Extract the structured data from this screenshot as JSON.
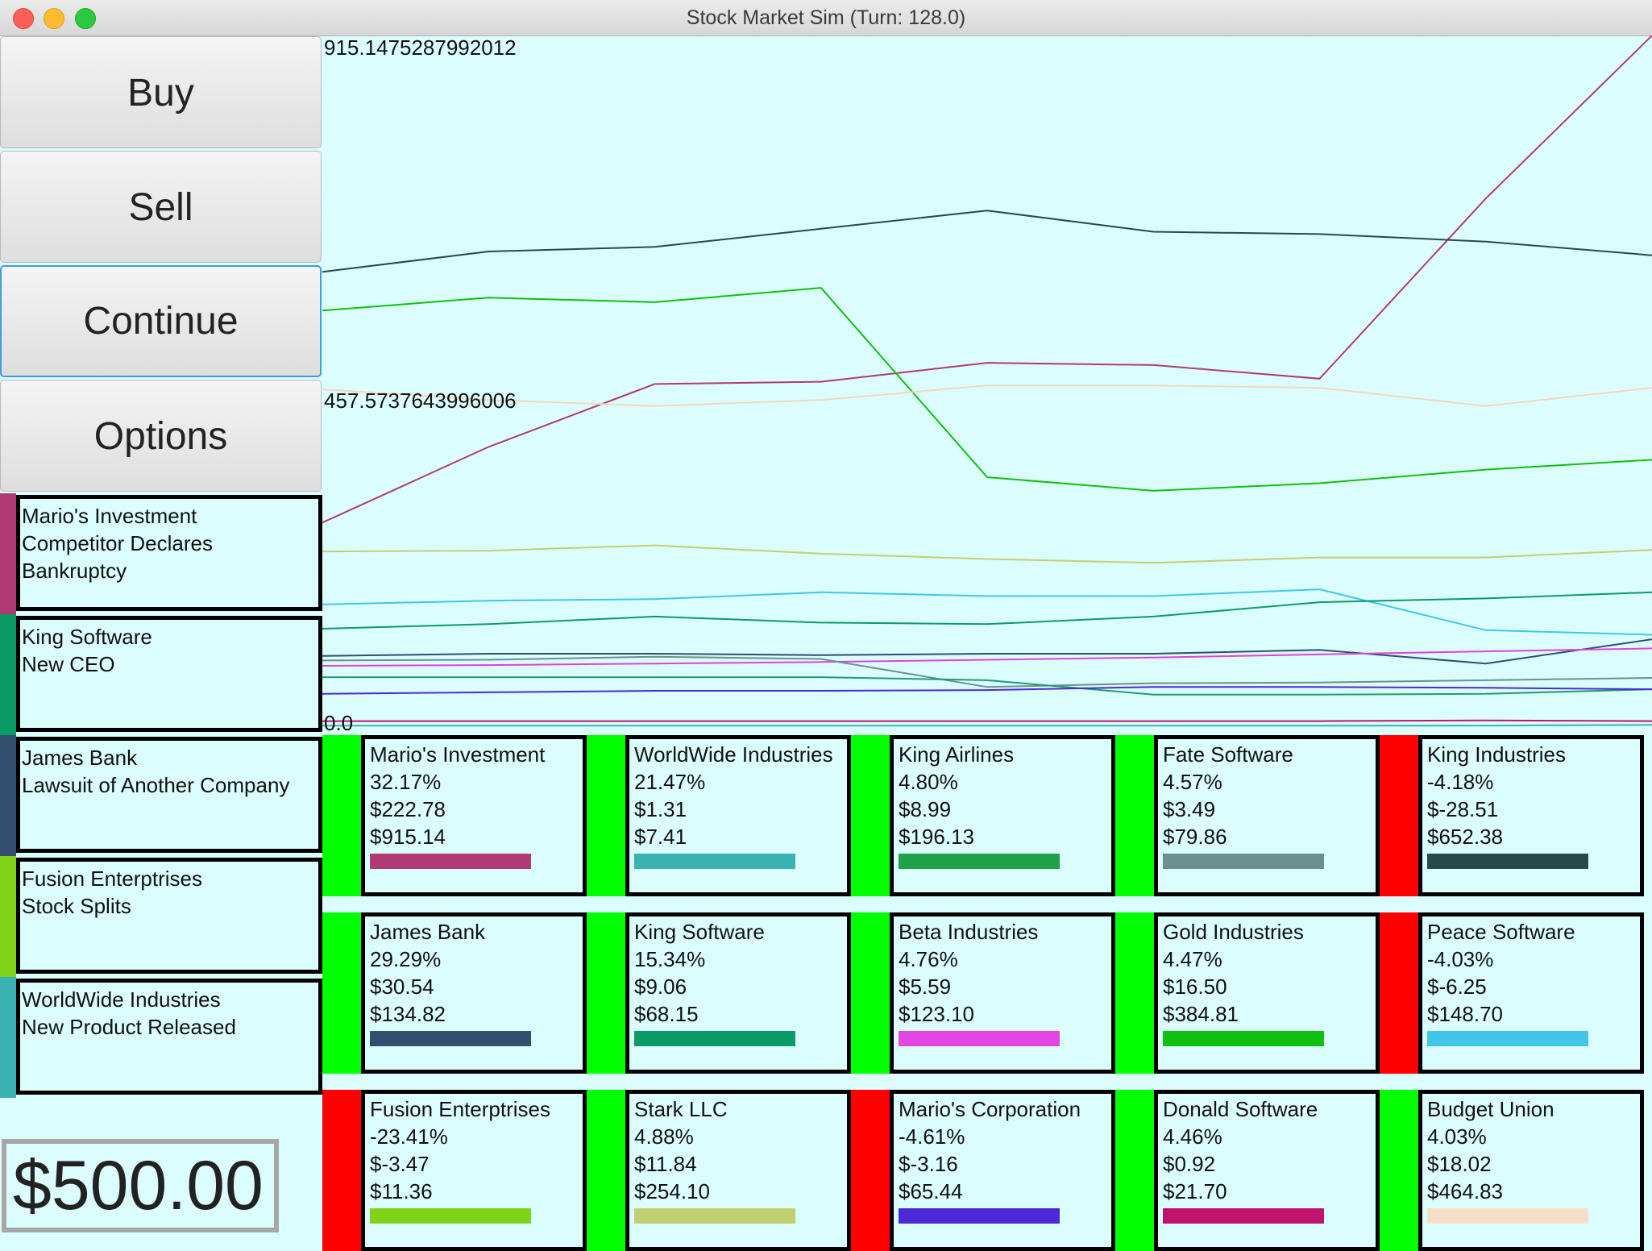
{
  "window": {
    "title": "Stock Market Sim (Turn: 128.0)"
  },
  "controls": {
    "buy": "Buy",
    "sell": "Sell",
    "continue": "Continue",
    "options": "Options"
  },
  "news": [
    {
      "text": "Mario's Investment\nCompetitor Declares\nBankruptcy",
      "color": "#b03a74"
    },
    {
      "text": "King Software\nNew CEO",
      "color": "#0b9b67"
    },
    {
      "text": "James Bank\nLawsuit of Another Company",
      "color": "#344e6f"
    },
    {
      "text": "Fusion Enterptrises\nStock Splits",
      "color": "#7fd41a"
    },
    {
      "text": "WorldWide Industries\nNew Product Released",
      "color": "#3ab2b4"
    }
  ],
  "cash": "$500.00",
  "chart_data": {
    "type": "line",
    "y_tick_labels": [
      "915.1475287992012",
      "457.5737643996006",
      "0.0"
    ],
    "ylim": [
      0,
      915.1475287992012
    ],
    "x": [
      0,
      1,
      2,
      3,
      4,
      5,
      6,
      7,
      8
    ],
    "series": [
      {
        "color": "#b03a74",
        "values": [
          272,
          372,
          455,
          458,
          483,
          480,
          462,
          700,
          915
        ]
      },
      {
        "color": "#264a4a",
        "values": [
          603,
          630,
          636,
          660,
          684,
          656,
          653,
          643,
          625
        ]
      },
      {
        "color": "#10c010",
        "values": [
          552,
          569,
          563,
          582,
          332,
          314,
          324,
          342,
          355
        ]
      },
      {
        "color": "#f2d8bf",
        "values": [
          448,
          434,
          426,
          434,
          453,
          453,
          450,
          426,
          450
        ]
      },
      {
        "color": "#c2cf72",
        "values": [
          234,
          235,
          242,
          231,
          224,
          219,
          226,
          226,
          236
        ]
      },
      {
        "color": "#41c6e8",
        "values": [
          164,
          169,
          171,
          180,
          175,
          175,
          184,
          130,
          124
        ]
      },
      {
        "color": "#0b9b67",
        "values": [
          132,
          138,
          148,
          140,
          138,
          148,
          167,
          172,
          180
        ]
      },
      {
        "color": "#2f4f6f",
        "values": [
          96,
          99,
          99,
          97,
          99,
          99,
          104,
          86,
          118
        ]
      },
      {
        "color": "#e040e0",
        "values": [
          83,
          84,
          86,
          88,
          91,
          94,
          98,
          102,
          106
        ]
      },
      {
        "color": "#6a9090",
        "values": [
          90,
          91,
          95,
          92,
          55,
          60,
          61,
          64,
          67
        ]
      },
      {
        "color": "#1e9d6a",
        "values": [
          68,
          68,
          68,
          68,
          64,
          45,
          45,
          46,
          52
        ]
      },
      {
        "color": "#4a2ad6",
        "values": [
          46,
          48,
          50,
          50,
          51,
          55,
          55,
          54,
          52
        ]
      },
      {
        "color": "#c0146c",
        "values": [
          10,
          10,
          10,
          10,
          10,
          10,
          10,
          11,
          10
        ]
      },
      {
        "color": "#3ab2b4",
        "values": [
          4,
          4,
          4,
          4,
          4,
          4,
          4,
          4,
          5
        ]
      }
    ]
  },
  "stocks": [
    {
      "name": "Mario's Investment",
      "pct": "32.17%",
      "change": "$222.78",
      "price": "$915.14",
      "up": true,
      "color": "#b03a74"
    },
    {
      "name": "WorldWide Industries",
      "pct": "21.47%",
      "change": "$1.31",
      "price": "$7.41",
      "up": true,
      "color": "#3ab2b4"
    },
    {
      "name": "King Airlines",
      "pct": "4.80%",
      "change": "$8.99",
      "price": "$196.13",
      "up": true,
      "color": "#1fa149"
    },
    {
      "name": "Fate Software",
      "pct": "4.57%",
      "change": "$3.49",
      "price": "$79.86",
      "up": true,
      "color": "#6a9090"
    },
    {
      "name": "King Industries",
      "pct": "-4.18%",
      "change": "$-28.51",
      "price": "$652.38",
      "up": false,
      "color": "#264a4a"
    },
    {
      "name": "James Bank",
      "pct": "29.29%",
      "change": "$30.54",
      "price": "$134.82",
      "up": true,
      "color": "#344e6f"
    },
    {
      "name": "King Software",
      "pct": "15.34%",
      "change": "$9.06",
      "price": "$68.15",
      "up": true,
      "color": "#0b9b67"
    },
    {
      "name": "Beta Industries",
      "pct": "4.76%",
      "change": "$5.59",
      "price": "$123.10",
      "up": true,
      "color": "#e446e4"
    },
    {
      "name": "Gold Industries",
      "pct": "4.47%",
      "change": "$16.50",
      "price": "$384.81",
      "up": true,
      "color": "#10c010"
    },
    {
      "name": "Peace Software",
      "pct": "-4.03%",
      "change": "$-6.25",
      "price": "$148.70",
      "up": false,
      "color": "#41c6e8"
    },
    {
      "name": "Fusion Enterptrises",
      "pct": "-23.41%",
      "change": "$-3.47",
      "price": "$11.36",
      "up": false,
      "color": "#7fd41a"
    },
    {
      "name": "Stark LLC",
      "pct": "4.88%",
      "change": "$11.84",
      "price": "$254.10",
      "up": true,
      "color": "#c2cf72"
    },
    {
      "name": "Mario's Corporation",
      "pct": "-4.61%",
      "change": "$-3.16",
      "price": "$65.44",
      "up": false,
      "color": "#4a2ad6"
    },
    {
      "name": "Donald Software",
      "pct": "4.46%",
      "change": "$0.92",
      "price": "$21.70",
      "up": true,
      "color": "#c0146c"
    },
    {
      "name": "Budget Union",
      "pct": "4.03%",
      "change": "$18.02",
      "price": "$464.83",
      "up": true,
      "color": "#f6dfc6"
    }
  ],
  "status_colors": {
    "up": "#00ff00",
    "down": "#ff0000"
  }
}
